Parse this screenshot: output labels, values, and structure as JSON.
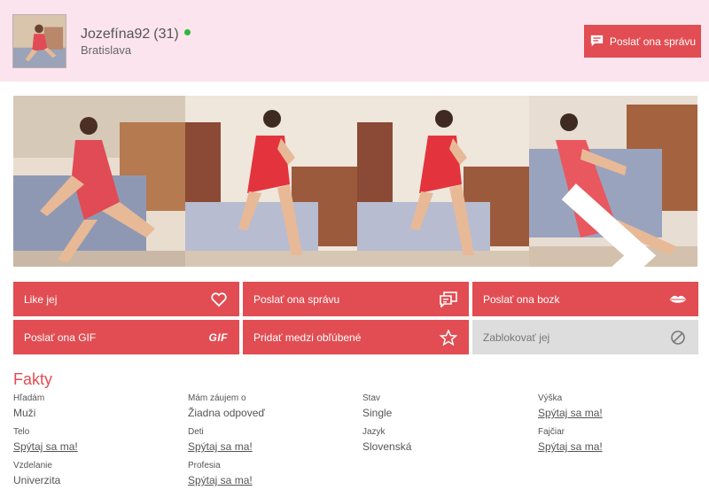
{
  "profile": {
    "username": "Jozefína92",
    "age": "(31)",
    "city": "Bratislava",
    "send_message_label": "Poslať ona správu"
  },
  "gallery": {
    "photos": [
      "photo-1",
      "photo-2",
      "photo-3",
      "photo-4"
    ]
  },
  "actions": [
    {
      "label": "Like jej",
      "icon": "heart-icon"
    },
    {
      "label": "Poslať ona správu",
      "icon": "chat-icon"
    },
    {
      "label": "Poslať ona bozk",
      "icon": "lips-icon"
    },
    {
      "label": "Poslať ona GIF",
      "icon": "gif-icon",
      "icon_text": "GIF"
    },
    {
      "label": "Pridať medzi obľúbené",
      "icon": "star-icon"
    },
    {
      "label": "Zablokovať jej",
      "icon": "block-icon"
    }
  ],
  "facts": {
    "title": "Fakty",
    "items": [
      {
        "label": "Hľadám",
        "value": "Muži",
        "link": false
      },
      {
        "label": "Mám záujem o",
        "value": "Žiadna odpoveď",
        "link": false
      },
      {
        "label": "Stav",
        "value": "Single",
        "link": false
      },
      {
        "label": "Výška",
        "value": "Spýtaj sa ma!",
        "link": true
      },
      {
        "label": "Telo",
        "value": "Spýtaj sa ma!",
        "link": true
      },
      {
        "label": "Deti",
        "value": "Spýtaj sa ma!",
        "link": true
      },
      {
        "label": "Jazyk",
        "value": "Slovenská",
        "link": false
      },
      {
        "label": "Fajčiar",
        "value": "Spýtaj sa ma!",
        "link": true
      },
      {
        "label": "Vzdelanie",
        "value": "Univerzita",
        "link": false
      },
      {
        "label": "Profesia",
        "value": "Spýtaj sa ma!",
        "link": true
      }
    ]
  },
  "colors": {
    "accent": "#e14d52",
    "header_bg": "#fce4ee",
    "online": "#2db83d",
    "disabled": "#dddddd"
  }
}
